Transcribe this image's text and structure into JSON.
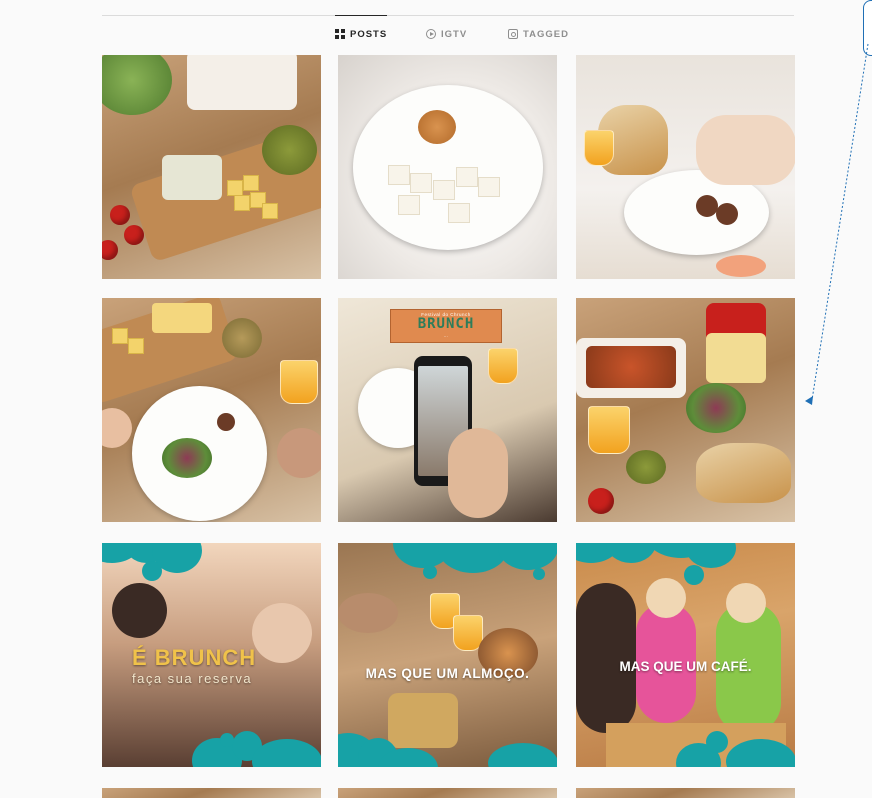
{
  "tabs": [
    {
      "label": "POSTS",
      "icon": "grid-icon",
      "active": true
    },
    {
      "label": "IGTV",
      "icon": "igtv-icon",
      "active": false
    },
    {
      "label": "TAGGED",
      "icon": "tagged-icon",
      "active": false
    }
  ],
  "posts": {
    "brunch_card": {
      "top_text": "Festival do Chrunch",
      "title": "BRUNCH",
      "sub": "…"
    },
    "post7": {
      "title": "É BRUNCH",
      "sub": "faça sua reserva"
    },
    "post8": {
      "text": "MAS QUE UM ALMOÇO."
    },
    "post9": {
      "text": "MAS QUE UM CAFÉ."
    }
  },
  "colors": {
    "accent_teal": "#17a2a6",
    "annotation_blue": "#1f6fb5"
  }
}
